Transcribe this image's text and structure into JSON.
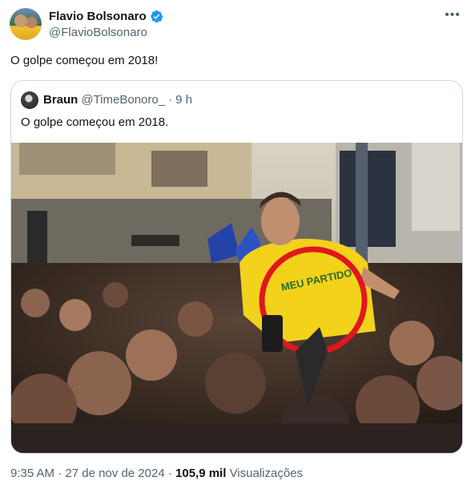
{
  "author": {
    "name": "Flavio Bolsonaro",
    "handle": "@FlavioBolsonaro"
  },
  "more_icon": "more-options-icon",
  "tweet_text": "O golpe começou em 2018!",
  "quoted": {
    "name": "Braun",
    "handle": "@TimeBonoro_",
    "separator": "·",
    "time": "9 h",
    "text": "O golpe começou em 2018."
  },
  "footer": {
    "time": "9:35 AM",
    "sep1": "·",
    "date": "27 de nov de 2024",
    "sep2": "·",
    "views_count": "105,9 mil",
    "views_label": "Visualizações"
  },
  "colors": {
    "verified": "#1d9bf0",
    "highlight_circle": "#e0171e",
    "shirt": "#f2d21b"
  },
  "image_shirt_text": "MEU PARTIDO"
}
